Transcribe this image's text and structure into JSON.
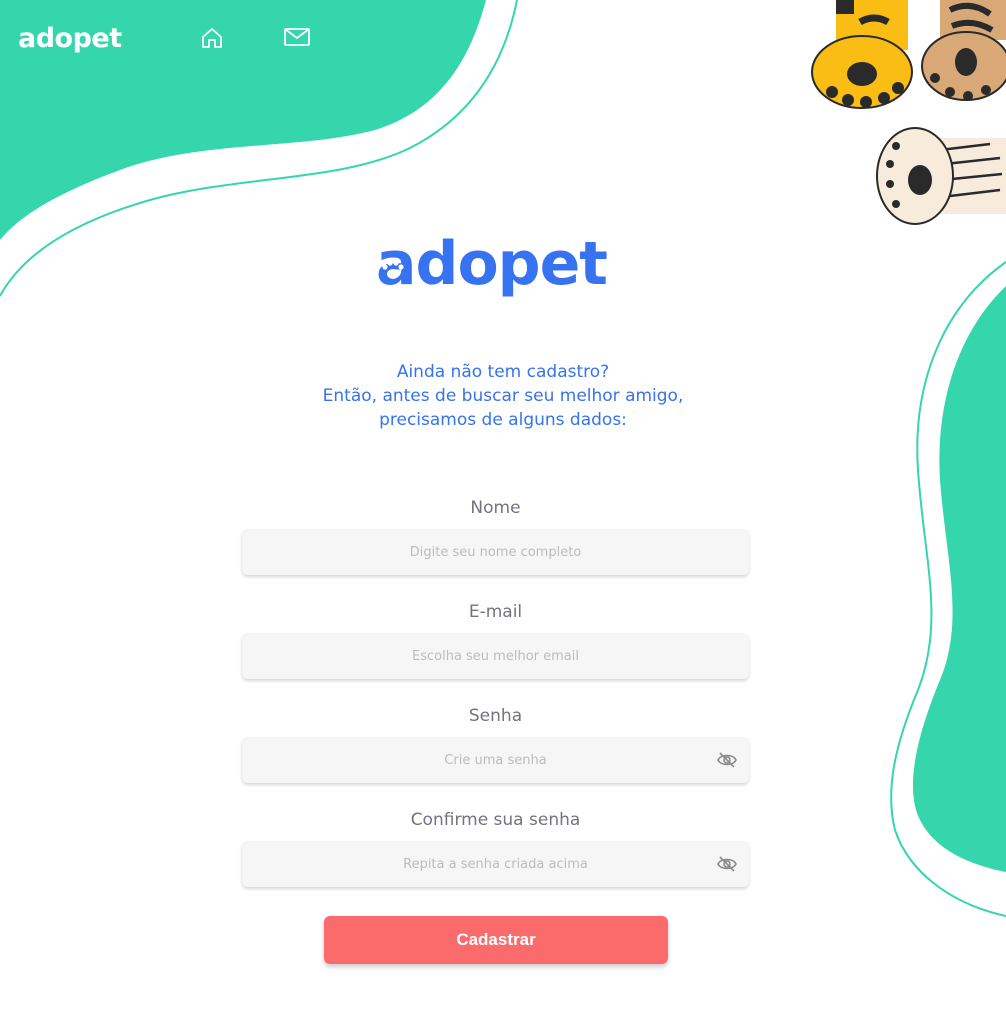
{
  "brand": {
    "logo_text": "adopet",
    "primary_color": "#3772f0",
    "accent_color": "#36d6ad",
    "button_color": "#fc6b6b"
  },
  "nav": {
    "items": [
      {
        "icon": "home-icon"
      },
      {
        "icon": "mail-icon"
      }
    ]
  },
  "intro": {
    "line1": "Ainda não tem cadastro?",
    "line2": "Então, antes de buscar seu melhor amigo, precisamos de alguns dados:"
  },
  "form": {
    "fields": [
      {
        "label": "Nome",
        "placeholder": "Digite seu nome completo",
        "value": ""
      },
      {
        "label": "E-mail",
        "placeholder": "Escolha seu melhor email",
        "value": ""
      },
      {
        "label": "Senha",
        "placeholder": "Crie uma senha",
        "value": "",
        "icon": "eye-off-icon"
      },
      {
        "label": "Confirme sua senha",
        "placeholder": "Repita a senha criada acima",
        "value": "",
        "icon": "eye-off-icon"
      }
    ],
    "submit_label": "Cadastrar"
  }
}
